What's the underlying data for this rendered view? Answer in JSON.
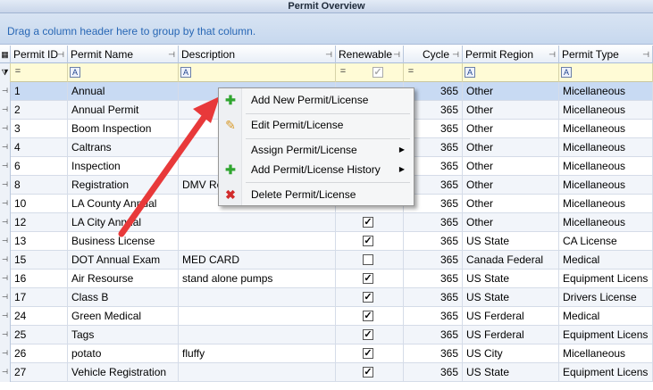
{
  "window": {
    "title": "Permit Overview"
  },
  "group_panel": {
    "hint": "Drag a column header here to group by that column."
  },
  "columns": [
    {
      "label": "Permit ID"
    },
    {
      "label": "Permit Name"
    },
    {
      "label": "Description"
    },
    {
      "label": "Renewable"
    },
    {
      "label": "Cycle"
    },
    {
      "label": "Permit Region"
    },
    {
      "label": "Permit Type"
    }
  ],
  "filter_ops": {
    "id": "=",
    "name": "A",
    "description": "A",
    "renewable": "=",
    "cycle": "=",
    "region": "A",
    "type": "A"
  },
  "rows": [
    {
      "id": "1",
      "name": "Annual",
      "description": "",
      "renewable": null,
      "cycle": "365",
      "region": "Other",
      "type": "Micellaneous"
    },
    {
      "id": "2",
      "name": "Annual Permit",
      "description": "",
      "renewable": null,
      "cycle": "365",
      "region": "Other",
      "type": "Micellaneous"
    },
    {
      "id": "3",
      "name": "Boom Inspection",
      "description": "",
      "renewable": null,
      "cycle": "365",
      "region": "Other",
      "type": "Micellaneous"
    },
    {
      "id": "4",
      "name": "Caltrans",
      "description": "",
      "renewable": null,
      "cycle": "365",
      "region": "Other",
      "type": "Micellaneous"
    },
    {
      "id": "6",
      "name": "Inspection",
      "description": "",
      "renewable": null,
      "cycle": "365",
      "region": "Other",
      "type": "Micellaneous"
    },
    {
      "id": "8",
      "name": "Registration",
      "description": "DMV Re",
      "renewable": null,
      "cycle": "365",
      "region": "Other",
      "type": "Micellaneous"
    },
    {
      "id": "10",
      "name": "LA County Annual",
      "description": "",
      "renewable": null,
      "cycle": "365",
      "region": "Other",
      "type": "Micellaneous"
    },
    {
      "id": "12",
      "name": "LA City Annual",
      "description": "",
      "renewable": true,
      "cycle": "365",
      "region": "Other",
      "type": "Micellaneous"
    },
    {
      "id": "13",
      "name": "Business License",
      "description": "",
      "renewable": true,
      "cycle": "365",
      "region": "US State",
      "type": "CA License"
    },
    {
      "id": "15",
      "name": "DOT Annual Exam",
      "description": "MED CARD",
      "renewable": false,
      "cycle": "365",
      "region": "Canada Federal",
      "type": "Medical"
    },
    {
      "id": "16",
      "name": "Air Resourse",
      "description": "stand alone pumps",
      "renewable": true,
      "cycle": "365",
      "region": "US State",
      "type": "Equipment Licens"
    },
    {
      "id": "17",
      "name": "Class B",
      "description": "",
      "renewable": true,
      "cycle": "365",
      "region": "US State",
      "type": "Drivers License"
    },
    {
      "id": "24",
      "name": "Green Medical",
      "description": "",
      "renewable": true,
      "cycle": "365",
      "region": "US Ferderal",
      "type": "Medical"
    },
    {
      "id": "25",
      "name": "Tags",
      "description": "",
      "renewable": true,
      "cycle": "365",
      "region": "US Ferderal",
      "type": "Equipment Licens"
    },
    {
      "id": "26",
      "name": "potato",
      "description": "fluffy",
      "renewable": true,
      "cycle": "365",
      "region": "US City",
      "type": "Micellaneous"
    },
    {
      "id": "27",
      "name": "Vehicle Registration",
      "description": "",
      "renewable": true,
      "cycle": "365",
      "region": "US State",
      "type": "Equipment Licens"
    }
  ],
  "context_menu": {
    "items": [
      {
        "label": "Add New Permit/License",
        "icon": "plus-icon",
        "submenu": false
      },
      {
        "label": "Edit Permit/License",
        "icon": "pencil-icon",
        "submenu": false
      },
      {
        "label": "Assign Permit/License",
        "icon": "",
        "submenu": true
      },
      {
        "label": "Add Permit/License History",
        "icon": "plus-icon",
        "submenu": true
      },
      {
        "label": "Delete Permit/License",
        "icon": "delete-icon",
        "submenu": false
      }
    ]
  },
  "colors": {
    "accent_blue": "#2867b5",
    "arrow_red": "#e8393a",
    "selected_row": "#c8daf3",
    "filter_row": "#fffbd6"
  }
}
